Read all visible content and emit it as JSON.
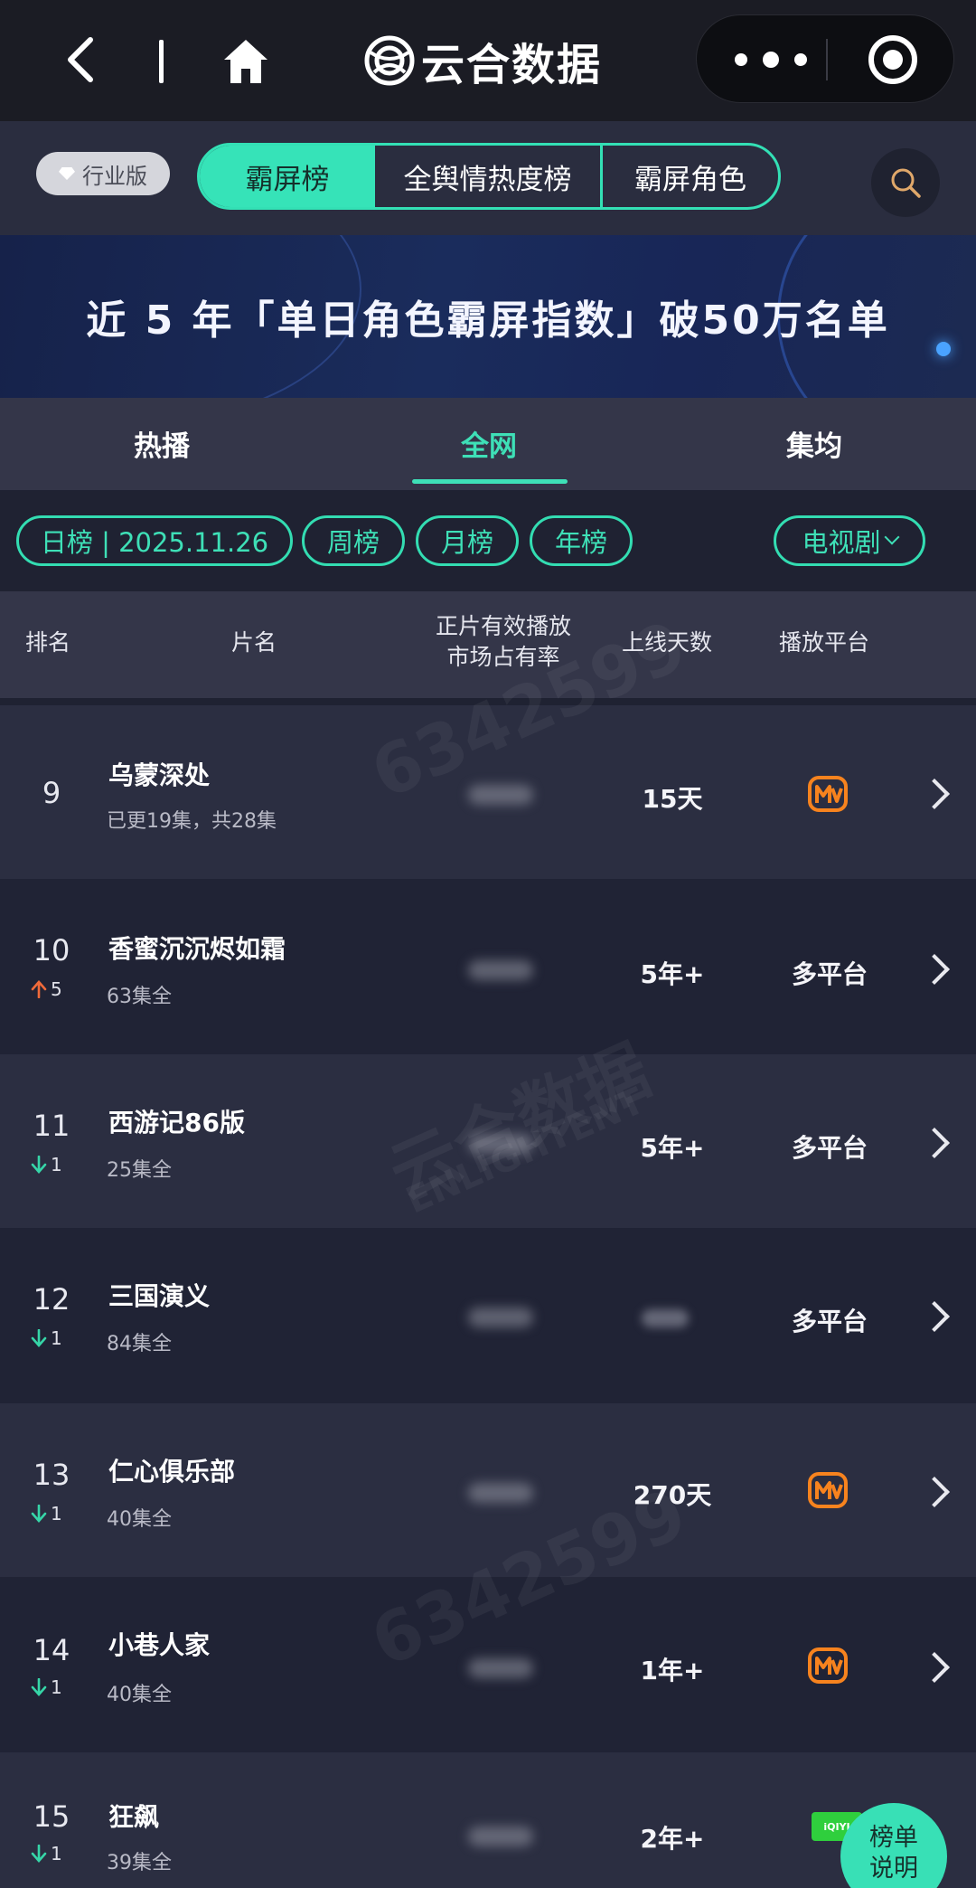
{
  "navbar": {
    "title": "云合数据",
    "icons": [
      "back-icon",
      "home-icon",
      "brand-logo-icon",
      "more-icon",
      "target-icon"
    ]
  },
  "toolbar": {
    "badge_label": "行业版",
    "tabs": [
      "霸屏榜",
      "全舆情热度榜",
      "霸屏角色"
    ],
    "active_tab": "霸屏榜"
  },
  "banner": {
    "text": "近 5 年「单日角色霸屏指数」破50万名单"
  },
  "subtabs": {
    "items": [
      "热播",
      "全网",
      "集均"
    ],
    "active": "全网"
  },
  "filters": {
    "daily": "日榜 | 2025.11.26",
    "weekly": "周榜",
    "monthly": "月榜",
    "yearly": "年榜",
    "category": "电视剧"
  },
  "table": {
    "headers": {
      "rank": "排名",
      "title": "片名",
      "share_line1": "正片有效播放",
      "share_line2": "市场占有率",
      "days": "上线天数",
      "platform": "播放平台"
    },
    "rows": [
      {
        "rank": "9",
        "change": "",
        "direction": "none",
        "title": "乌蒙深处",
        "sub": "已更19集，共28集",
        "days": "15天",
        "platform": "mango-tv-icon"
      },
      {
        "rank": "10",
        "change": "5",
        "direction": "up",
        "title": "香蜜沉沉烬如霜",
        "sub": "63集全",
        "days": "5年+",
        "platform": "多平台"
      },
      {
        "rank": "11",
        "change": "1",
        "direction": "down",
        "title": "西游记86版",
        "sub": "25集全",
        "days": "5年+",
        "platform": "多平台"
      },
      {
        "rank": "12",
        "change": "1",
        "direction": "down",
        "title": "三国演义",
        "sub": "84集全",
        "days": "",
        "platform": "多平台"
      },
      {
        "rank": "13",
        "change": "1",
        "direction": "down",
        "title": "仁心俱乐部",
        "sub": "40集全",
        "days": "270天",
        "platform": "mango-tv-icon"
      },
      {
        "rank": "14",
        "change": "1",
        "direction": "down",
        "title": "小巷人家",
        "sub": "40集全",
        "days": "1年+",
        "platform": "mango-tv-icon"
      },
      {
        "rank": "15",
        "change": "1",
        "direction": "down",
        "title": "狂飙",
        "sub": "39集全",
        "days": "2年+",
        "platform": "iqiyi-icon"
      }
    ]
  },
  "watermark": {
    "brand": "云合数据",
    "brand_en": "ENLIGHTENT",
    "number": "6342599"
  },
  "iqiyi_label": "iQIYI",
  "float_button": {
    "line1": "榜单",
    "line2": "说明"
  },
  "colors": {
    "accent": "#36E3B8",
    "up": "#F06A3A",
    "down": "#36D6A8",
    "mango": "#F7831E",
    "iqiyi": "#2FCF3D"
  }
}
